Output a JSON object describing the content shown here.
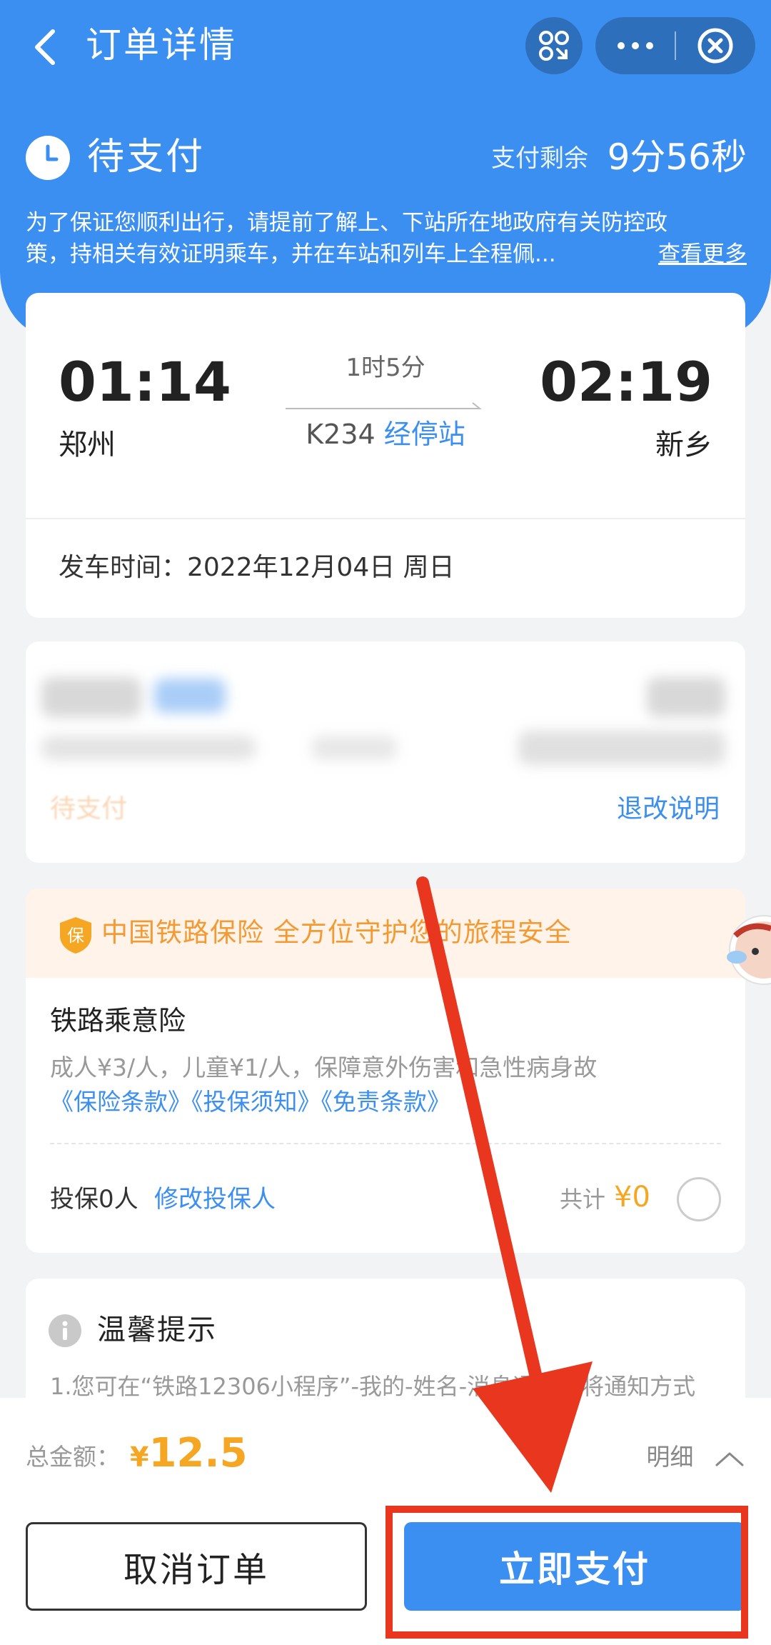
{
  "nav": {
    "back_icon": "chevron-left-icon",
    "title": "订单详情",
    "qr_icon": "scan-icon",
    "more_icon": "more-dots-icon",
    "close_icon": "close-circle-icon"
  },
  "status": {
    "icon": "clock-icon",
    "text": "待支付",
    "remain_label": "支付剩余",
    "remain_time": "9分56秒"
  },
  "notice": {
    "line1": "为了保证您顺利出行，请提前了解上、下站所在地政府有关防控政",
    "line2": "策，持相关有效证明乘车，并在车站和列车上全程佩...",
    "more_link": "查看更多"
  },
  "trip": {
    "depart_time": "01:14",
    "depart_city": "郑州",
    "arrive_time": "02:19",
    "arrive_city": "新乡",
    "duration": "1时5分",
    "train_no": "K234",
    "stops_link": "经停站",
    "depart_datetime": "发车时间：2022年12月04日 周日"
  },
  "passenger": {
    "status": "待支付",
    "refund_link": "退改说明"
  },
  "insurance": {
    "slogan": "中国铁路保险 全方位守护您的旅程安全",
    "badge_icon": "shield-icon",
    "badge_char": "保",
    "product": "铁路乘意险",
    "desc": "成人¥3/人，儿童¥1/人，保障意外伤害和急性病身故",
    "links": "《保险条款》《投保须知》《免责条款》",
    "insured_count": "投保0人",
    "modify_link": "修改投保人",
    "total_label": "共计",
    "total_value": "¥0"
  },
  "tips": {
    "icon": "info-icon",
    "title": "温馨提示",
    "text": "1.您可在“铁路12306小程序”-我的-姓名-消息通知，将通知方式"
  },
  "footer": {
    "total_label": "总金额：",
    "currency": "¥",
    "total_amount": "12.5",
    "detail_label": "明细",
    "cancel_label": "取消订单",
    "pay_label": "立即支付"
  },
  "colors": {
    "brand_blue": "#3b8ff0",
    "price_orange": "#f5a623",
    "highlight_red": "#e8361f"
  }
}
